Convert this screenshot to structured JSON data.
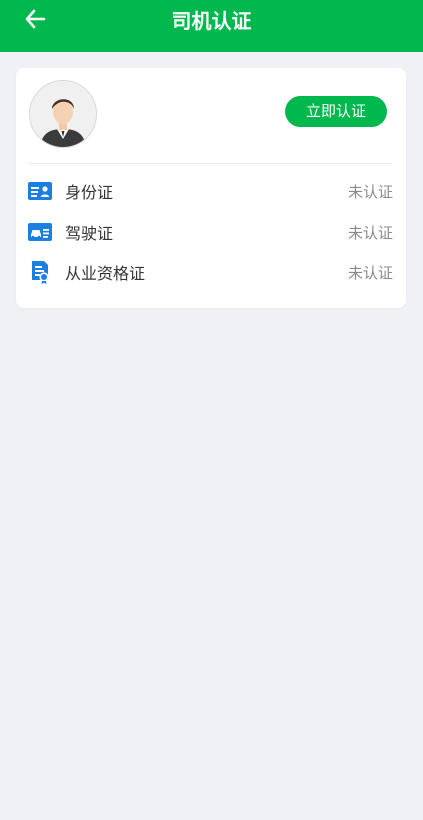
{
  "header": {
    "title": "司机认证",
    "background_color": "#00b84d"
  },
  "profile": {
    "auth_button_label": "立即认证"
  },
  "items": [
    {
      "label": "身份证",
      "status": "未认证",
      "icon": "id-card-icon"
    },
    {
      "label": "驾驶证",
      "status": "未认证",
      "icon": "driver-license-icon"
    },
    {
      "label": "从业资格证",
      "status": "未认证",
      "icon": "qualification-certificate-icon"
    }
  ],
  "colors": {
    "accent": "#00b84d",
    "icon_blue": "#1a7fe0"
  }
}
